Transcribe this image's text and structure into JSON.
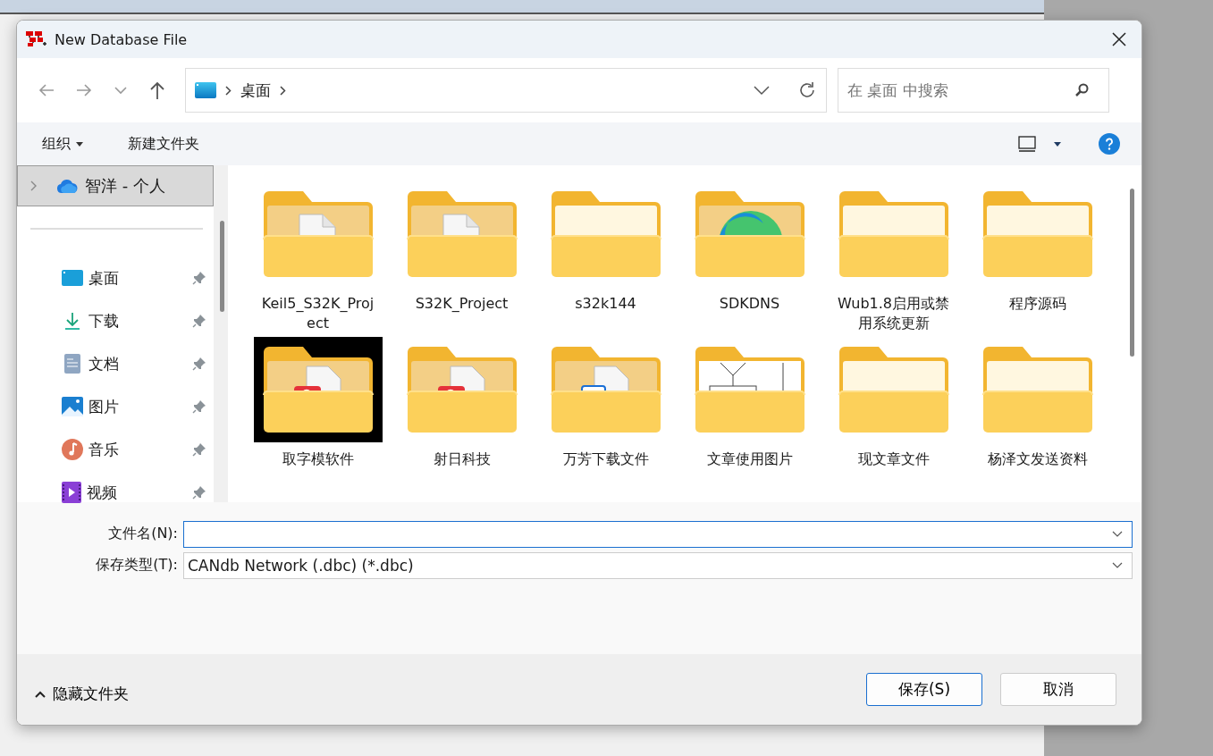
{
  "window": {
    "title": "New Database File"
  },
  "address": {
    "crumbs": [
      "桌面"
    ]
  },
  "search": {
    "placeholder": "在 桌面 中搜索"
  },
  "toolbar": {
    "organize": "组织",
    "new_folder": "新建文件夹"
  },
  "sidebar": {
    "account": {
      "label": "智洋 - 个人",
      "selected": true,
      "expanded": false
    },
    "items": [
      {
        "label": "桌面",
        "kind": "desktop",
        "pinned": true
      },
      {
        "label": "下载",
        "kind": "download",
        "pinned": true
      },
      {
        "label": "文档",
        "kind": "documents",
        "pinned": true
      },
      {
        "label": "图片",
        "kind": "pictures",
        "pinned": true
      },
      {
        "label": "音乐",
        "kind": "music",
        "pinned": true
      },
      {
        "label": "视频",
        "kind": "videos",
        "pinned": true
      }
    ]
  },
  "files": [
    {
      "name": "Keil5_S32K_Project",
      "kind": "document",
      "dark_thumb": false
    },
    {
      "name": "S32K_Project",
      "kind": "document",
      "dark_thumb": false
    },
    {
      "name": "s32k144",
      "kind": "plain",
      "dark_thumb": false
    },
    {
      "name": "SDKDNS",
      "kind": "edge",
      "dark_thumb": false
    },
    {
      "name": "Wub1.8启用或禁用系统更新",
      "kind": "plain",
      "dark_thumb": false
    },
    {
      "name": "程序源码",
      "kind": "plain",
      "dark_thumb": false
    },
    {
      "name": "取字模软件",
      "kind": "pdf",
      "dark_thumb": true
    },
    {
      "name": "射日科技",
      "kind": "pdf",
      "dark_thumb": false
    },
    {
      "name": "万芳下载文件",
      "kind": "word",
      "dark_thumb": false
    },
    {
      "name": "文章使用图片",
      "kind": "flowchart",
      "dark_thumb": false
    },
    {
      "name": "现文章文件",
      "kind": "plain",
      "dark_thumb": false
    },
    {
      "name": "杨泽文发送资料",
      "kind": "plain",
      "dark_thumb": false
    }
  ],
  "form": {
    "filename_label": "文件名(N):",
    "type_label": "保存类型(T):",
    "type_value": "CANdb Network (.dbc) (*.dbc)"
  },
  "footer": {
    "hide_folders": "隐藏文件夹",
    "save": "保存(S)",
    "cancel": "取消"
  }
}
